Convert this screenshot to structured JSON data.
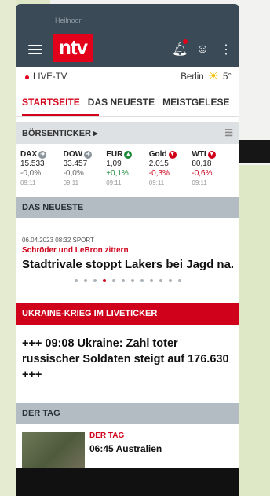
{
  "header": {
    "logo_text": "ntv",
    "faded_text": "Heilnoon"
  },
  "icons": {
    "menu": "hamburger-icon",
    "notifications": "bell-icon",
    "account": "user-icon",
    "more": "more-vertical-icon"
  },
  "livebar": {
    "live_label": "LIVE-TV",
    "city": "Berlin",
    "temperature": "5°"
  },
  "tabs": [
    {
      "label": "STARTSEITE"
    },
    {
      "label": "DAS NEUESTE"
    },
    {
      "label": "MEISTGELESE"
    }
  ],
  "ticker": {
    "title": "BÖRSENTICKER",
    "items": [
      {
        "name": "DAX",
        "value": "15.533",
        "change": "-0,0%",
        "time": "09:11",
        "trend": "neu"
      },
      {
        "name": "DOW",
        "value": "33.457",
        "change": "-0,0%",
        "time": "09:11",
        "trend": "neu"
      },
      {
        "name": "EUR",
        "value": "1,09",
        "change": "+0,1%",
        "time": "09:11",
        "trend": "up"
      },
      {
        "name": "Gold",
        "value": "2.015",
        "change": "-0,3%",
        "time": "09:11",
        "trend": "down"
      },
      {
        "name": "WTI",
        "value": "80,18",
        "change": "-0,6%",
        "time": "09:11",
        "trend": "down"
      }
    ]
  },
  "neueste": {
    "section_title": "DAS NEUESTE",
    "meta": "06.04.2023 08:32 SPORT",
    "kicker": "Schröder und LeBron zittern",
    "headline": "Stadtrivale stoppt Lakers bei Jagd na...",
    "dot_count": 12,
    "active_dot": 3
  },
  "ukraine": {
    "section_title": "UKRAINE-KRIEG IM LIVETICKER",
    "headline": "+++ 09:08 Ukraine: Zahl toter russischer Soldaten steigt auf 176.630 +++"
  },
  "dertag": {
    "section_title": "DER TAG",
    "kicker": "DER TAG",
    "text": "06:45 Australien"
  }
}
